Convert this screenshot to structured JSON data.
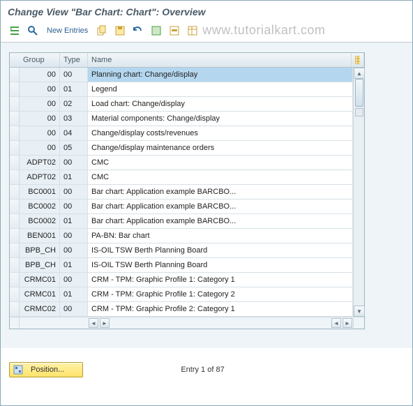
{
  "title": "Change View \"Bar Chart: Chart\": Overview",
  "toolbar": {
    "new_entries": "New Entries"
  },
  "watermark": "www.tutorialkart.com",
  "columns": {
    "group": "Group",
    "type": "Type",
    "name": "Name"
  },
  "rows": [
    {
      "group": "00",
      "type": "00",
      "name": "Planning chart: Change/display",
      "selected": true
    },
    {
      "group": "00",
      "type": "01",
      "name": "Legend"
    },
    {
      "group": "00",
      "type": "02",
      "name": "Load chart: Change/display"
    },
    {
      "group": "00",
      "type": "03",
      "name": "Material components: Change/display"
    },
    {
      "group": "00",
      "type": "04",
      "name": "Change/display costs/revenues"
    },
    {
      "group": "00",
      "type": "05",
      "name": "Change/display maintenance orders"
    },
    {
      "group": "ADPT02",
      "type": "00",
      "name": "CMC"
    },
    {
      "group": "ADPT02",
      "type": "01",
      "name": "CMC"
    },
    {
      "group": "BC0001",
      "type": "00",
      "name": "Bar chart: Application example BARCBO..."
    },
    {
      "group": "BC0002",
      "type": "00",
      "name": "Bar chart: Application example BARCBO..."
    },
    {
      "group": "BC0002",
      "type": "01",
      "name": "Bar chart: Application example BARCBO..."
    },
    {
      "group": "BEN001",
      "type": "00",
      "name": "PA-BN: Bar chart"
    },
    {
      "group": "BPB_CH",
      "type": "00",
      "name": "IS-OIL TSW Berth Planning Board"
    },
    {
      "group": "BPB_CH",
      "type": "01",
      "name": "IS-OIL TSW Berth Planning Board"
    },
    {
      "group": "CRMC01",
      "type": "00",
      "name": "CRM - TPM: Graphic Profile 1: Category 1"
    },
    {
      "group": "CRMC01",
      "type": "01",
      "name": "CRM - TPM: Graphic Profile 1: Category 2"
    },
    {
      "group": "CRMC02",
      "type": "00",
      "name": "CRM - TPM: Graphic Profile 2: Category 1"
    }
  ],
  "footer": {
    "position_label": "Position...",
    "entry_text": "Entry 1 of 87"
  }
}
